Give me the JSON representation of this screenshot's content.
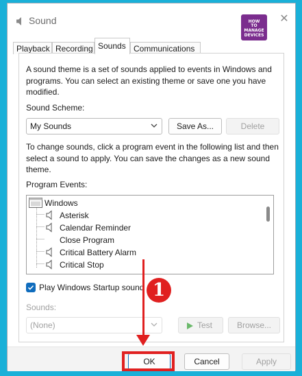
{
  "window": {
    "title": "Sound",
    "logo_lines": [
      "HOW",
      "TO",
      "MANAGE",
      "DEVICES"
    ]
  },
  "tabs": [
    {
      "label": "Playback",
      "selected": false
    },
    {
      "label": "Recording",
      "selected": false
    },
    {
      "label": "Sounds",
      "selected": true
    },
    {
      "label": "Communications",
      "selected": false
    }
  ],
  "sounds_tab": {
    "intro": "A sound theme is a set of sounds applied to events in Windows and programs.  You can select an existing theme or save one you have modified.",
    "scheme_label": "Sound Scheme:",
    "scheme_value": "My Sounds",
    "save_as_label": "Save As...",
    "delete_label": "Delete",
    "instructions": "To change sounds, click a program event in the following list and then select a sound to apply.  You can save the changes as a new sound theme.",
    "events_label": "Program Events:",
    "events": [
      {
        "label": "Windows",
        "type": "group",
        "has_speaker": false
      },
      {
        "label": "Asterisk",
        "type": "event",
        "has_speaker": true
      },
      {
        "label": "Calendar Reminder",
        "type": "event",
        "has_speaker": true
      },
      {
        "label": "Close Program",
        "type": "event",
        "has_speaker": false
      },
      {
        "label": "Critical Battery Alarm",
        "type": "event",
        "has_speaker": true
      },
      {
        "label": "Critical Stop",
        "type": "event",
        "has_speaker": true
      }
    ],
    "startup_label": "Play Windows Startup sound",
    "startup_checked": true,
    "sounds_label": "Sounds:",
    "sound_value": "(None)",
    "test_label": "Test",
    "browse_label": "Browse..."
  },
  "footer": {
    "ok_label": "OK",
    "cancel_label": "Cancel",
    "apply_label": "Apply"
  },
  "annotation": {
    "step": "1",
    "color": "#e02020"
  },
  "colors": {
    "background": "#1ab0d8",
    "accent": "#0f6cbd",
    "logo": "#7b2d8e"
  }
}
